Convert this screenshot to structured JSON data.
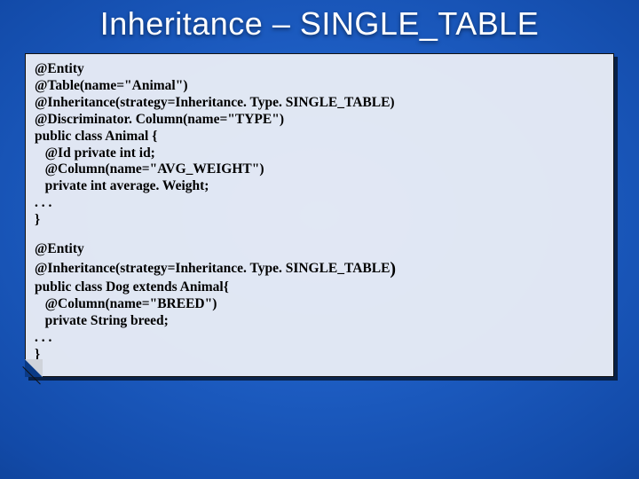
{
  "title": "Inheritance – SINGLE_TABLE",
  "code": {
    "l01": "@Entity",
    "l02": "@Table(name=\"Animal\")",
    "l03": "@Inheritance(strategy=Inheritance. Type. SINGLE_TABLE)",
    "l04": "@Discriminator. Column(name=\"TYPE\")",
    "l05": "public class Animal {",
    "l06": "   @Id private int id;",
    "l07": "   @Column(name=\"AVG_WEIGHT\")",
    "l08": "   private int average. Weight;",
    "l09": ". . .",
    "l10": "}",
    "l11": "@Entity",
    "l12a": "@Inheritance(strategy=Inheritance. Type. SINGLE_TABLE",
    "l12b": ")",
    "l13": "public class Dog extends Animal{",
    "l14": "   @Column(name=\"BREED\")",
    "l15": "   private String breed;",
    "l16": ". . .",
    "l17": "}"
  }
}
